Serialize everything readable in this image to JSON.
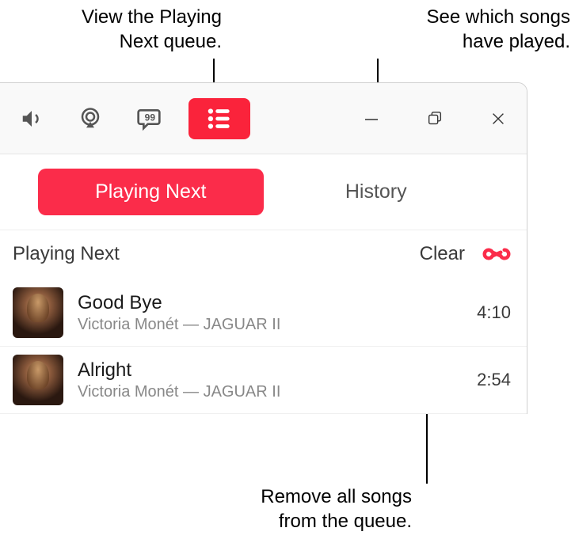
{
  "callouts": {
    "queue": "View the Playing\nNext queue.",
    "history": "See which songs\nhave played.",
    "clear": "Remove all songs\nfrom the queue."
  },
  "tabs": {
    "playing_next": "Playing Next",
    "history": "History"
  },
  "section": {
    "title": "Playing Next",
    "clear": "Clear"
  },
  "tracks": [
    {
      "title": "Good Bye",
      "artist": "Victoria Monét — JAGUAR II",
      "duration": "4:10"
    },
    {
      "title": "Alright",
      "artist": "Victoria Monét — JAGUAR II",
      "duration": "2:54"
    }
  ]
}
